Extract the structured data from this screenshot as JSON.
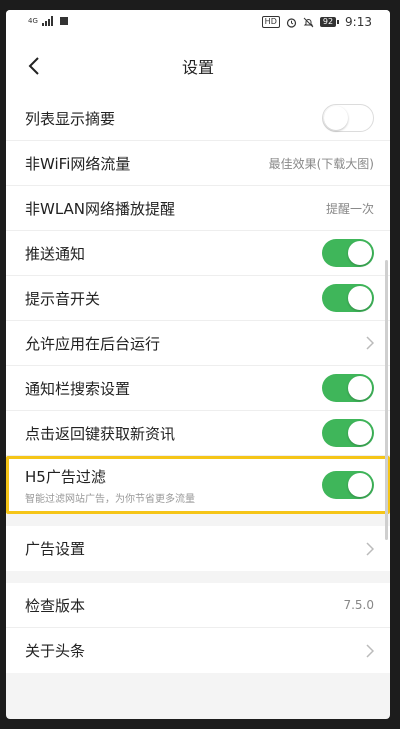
{
  "status_bar": {
    "network": "4G",
    "hd": "HD",
    "battery": "92",
    "time": "9:13"
  },
  "header": {
    "title": "设置",
    "back_icon": "chevron-left-icon"
  },
  "settings": {
    "row_summary": {
      "label": "列表显示摘要",
      "toggle": "off"
    },
    "row_wifi_traffic": {
      "label": "非WiFi网络流量",
      "value": "最佳效果(下载大图)"
    },
    "row_wlan_remind": {
      "label": "非WLAN网络播放提醒",
      "value": "提醒一次"
    },
    "row_push": {
      "label": "推送通知",
      "toggle": "on"
    },
    "row_sound": {
      "label": "提示音开关",
      "toggle": "on"
    },
    "row_background": {
      "label": "允许应用在后台运行"
    },
    "row_notif_search": {
      "label": "通知栏搜索设置",
      "toggle": "on"
    },
    "row_back_refresh": {
      "label": "点击返回键获取新资讯",
      "toggle": "on"
    },
    "row_h5_filter": {
      "label": "H5广告过滤",
      "sublabel": "智能过滤网站广告，为你节省更多流量",
      "toggle": "on"
    },
    "row_ad_settings": {
      "label": "广告设置"
    },
    "row_version": {
      "label": "检查版本",
      "value": "7.5.0"
    },
    "row_about": {
      "label": "关于头条"
    }
  },
  "colors": {
    "toggle_on": "#3fb65a",
    "highlight": "#f5c518"
  }
}
